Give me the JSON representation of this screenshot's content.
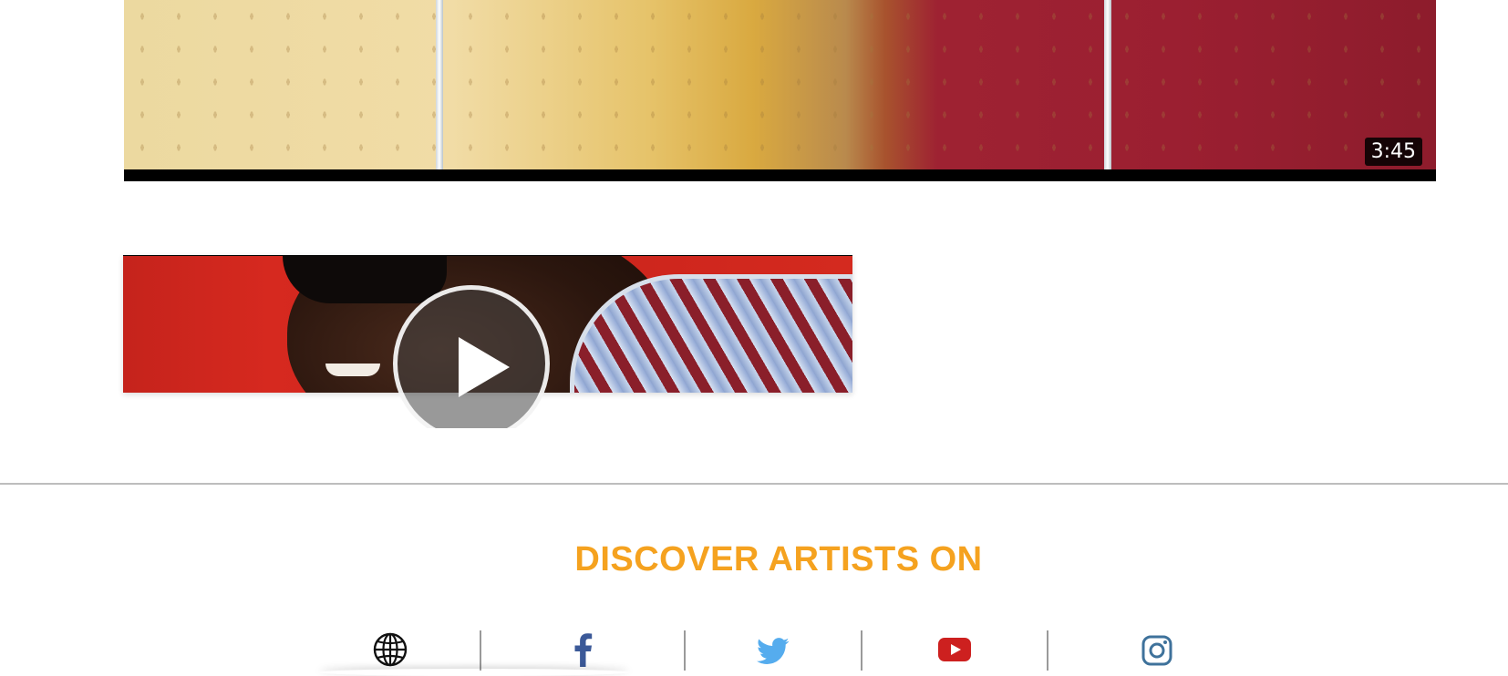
{
  "top_video": {
    "duration": "3:45"
  },
  "second_video": {
    "play_icon": "play-icon"
  },
  "discover": {
    "title": "DISCOVER ARTISTS ON"
  },
  "social": [
    {
      "name": "website",
      "icon": "globe-icon",
      "color": "#111111"
    },
    {
      "name": "facebook",
      "icon": "facebook-icon",
      "color": "#3b5998"
    },
    {
      "name": "twitter",
      "icon": "twitter-icon",
      "color": "#55acee"
    },
    {
      "name": "youtube",
      "icon": "youtube-icon",
      "color": "#cd201f"
    },
    {
      "name": "instagram",
      "icon": "instagram-icon",
      "color": "#3f729b"
    }
  ],
  "colors": {
    "accent": "#f5a21f",
    "divider": "#bdbdbd"
  }
}
